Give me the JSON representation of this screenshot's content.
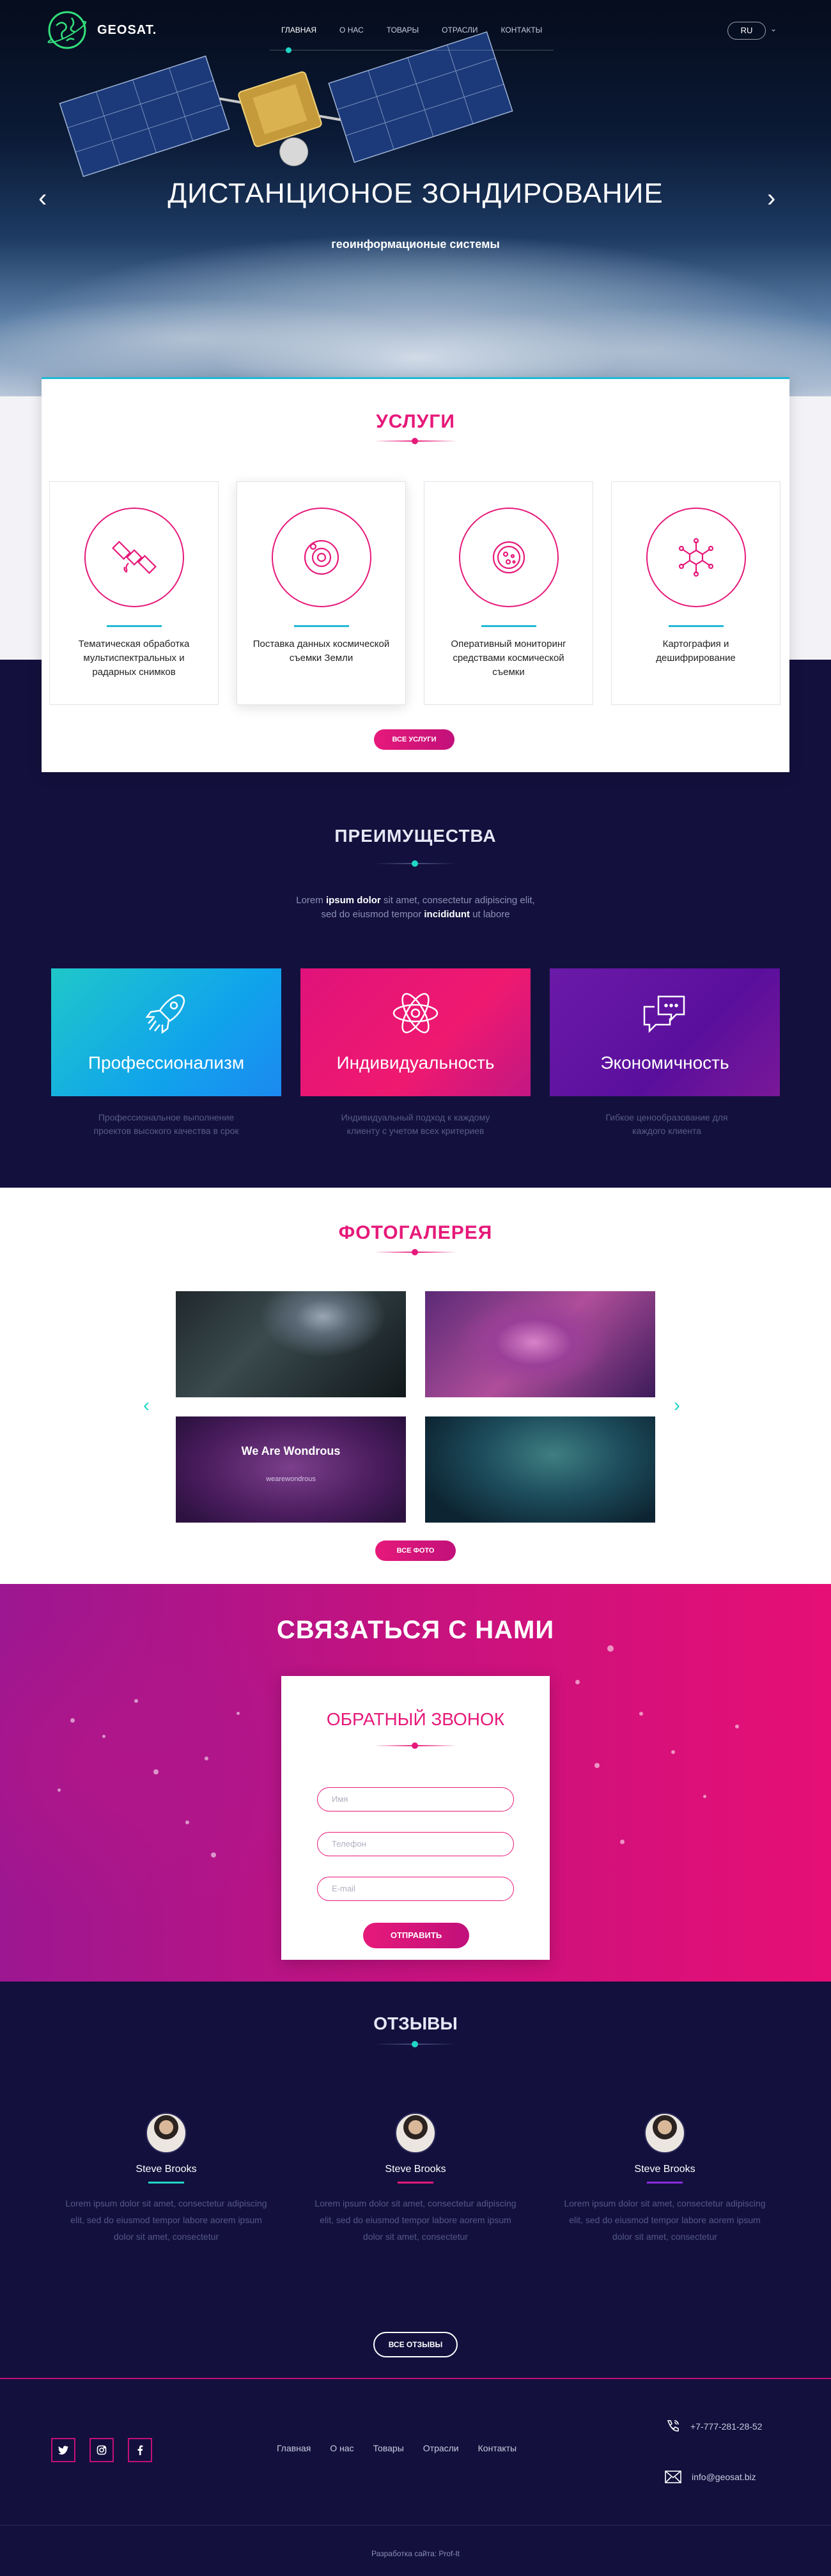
{
  "header": {
    "logo_text": "GEOSAT.",
    "nav": [
      "ГЛАВНАЯ",
      "О НАС",
      "ТОВАРЫ",
      "ОТРАСЛИ",
      "КОНТАКТЫ"
    ],
    "lang": "RU"
  },
  "hero": {
    "title": "ДИСТАНЦИОНОЕ ЗОНДИРОВАНИЕ",
    "subtitle": "геоинформационые системы"
  },
  "services": {
    "title": "УСЛУГИ",
    "items": [
      {
        "label": "Тематическая обработка мультиспектральных и радарных снимков",
        "icon": "satellite-icon"
      },
      {
        "label": "Поставка данных космической съемки Земли",
        "icon": "planet-orbit-icon"
      },
      {
        "label": "Оперативный мониторинг средствами космической съемки",
        "icon": "monitoring-icon"
      },
      {
        "label": "Картография и дешифрирование",
        "icon": "molecule-icon"
      }
    ],
    "button": "ВСЕ УСЛУГИ"
  },
  "advantages": {
    "title": "ПРЕИМУЩЕСТВА",
    "text_line1_pre": "Lorem ",
    "text_line1_bold": "ipsum dolor",
    "text_line1_post": " sit amet, consectetur adipiscing elit,",
    "text_line2_pre": "sed do eiusmod tempor ",
    "text_line2_bold": "incididunt",
    "text_line2_post": " ut labore",
    "items": [
      {
        "title": "Профессионализм",
        "desc": "Профессиональное выполнение проектов высокого качества в срок",
        "icon": "rocket-icon"
      },
      {
        "title": "Индивидуальность",
        "desc": "Индивидуальный подход к каждому клиенту с учетом всех критериев",
        "icon": "atom-icon"
      },
      {
        "title": "Экономичность",
        "desc": "Гибкое ценообразование для каждого клиента",
        "icon": "chat-bubbles-icon"
      }
    ]
  },
  "gallery": {
    "title": "ФОТОГАЛЕРЕЯ",
    "overlay_title": "We Are Wondrous",
    "overlay_sub": "wearewondrous",
    "button": "ВСЕ ФОТО"
  },
  "contact": {
    "title": "СВЯЗАТЬСЯ С НАМИ",
    "form_title": "ОБРАТНЫЙ ЗВОНОК",
    "name_placeholder": "Имя",
    "phone_placeholder": "Телефон",
    "email_placeholder": "E-mail",
    "submit": "ОТПРАВИТЬ"
  },
  "reviews": {
    "title": "ОТЗЫВЫ",
    "items": [
      {
        "name": "Steve Brooks",
        "text": "Lorem ipsum dolor sit amet, consectetur adipiscing elit, sed do eiusmod tempor labore aorem ipsum dolor sit amet, consectetur",
        "color": "#20d6c6"
      },
      {
        "name": "Steve Brooks",
        "text": "Lorem ipsum dolor sit amet, consectetur adipiscing elit, sed do eiusmod tempor labore aorem ipsum dolor sit amet, consectetur",
        "color": "#e6197a"
      },
      {
        "name": "Steve Brooks",
        "text": "Lorem ipsum dolor sit amet, consectetur adipiscing elit, sed do eiusmod tempor labore aorem ipsum dolor sit amet, consectetur",
        "color": "#8a2be2"
      }
    ],
    "button": "ВСЕ ОТЗЫВЫ"
  },
  "footer": {
    "social": [
      "twitter-icon",
      "instagram-icon",
      "facebook-icon"
    ],
    "nav": [
      "Главная",
      "О нас",
      "Товары",
      "Отрасли",
      "Контакты"
    ],
    "phone": "+7-777-281-28-52",
    "email": "info@geosat.biz",
    "copyright": "Разработка сайта: Prof-It"
  },
  "colors": {
    "accent_pink": "#e6197a",
    "accent_teal": "#20d6c6",
    "navy": "#13103d"
  }
}
